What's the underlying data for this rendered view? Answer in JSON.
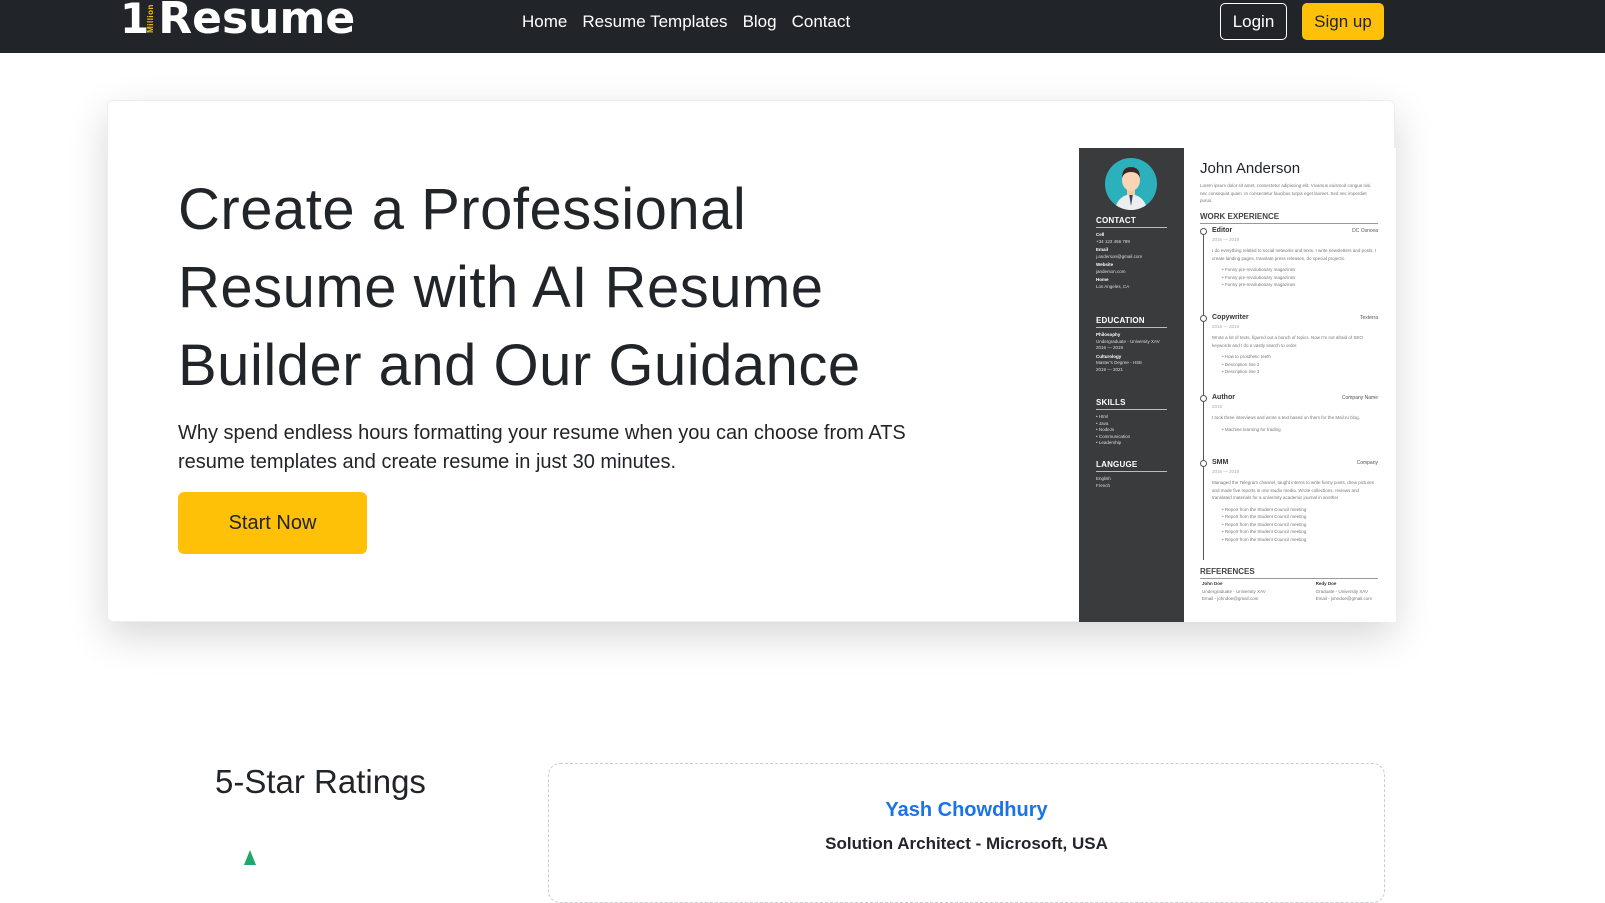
{
  "navbar": {
    "brand_one": "1",
    "brand_million": "Million",
    "brand_word": "Resume",
    "links": [
      {
        "label": "Home"
      },
      {
        "label": "Resume Templates"
      },
      {
        "label": "Blog"
      },
      {
        "label": "Contact"
      }
    ],
    "login_label": "Login",
    "signup_label": "Sign up"
  },
  "hero": {
    "title": "Create a Professional Resume with AI Resume Builder and Our Guidance",
    "subtitle": "Why spend endless hours formatting your resume when you can choose from ATS resume templates and create resume in just 30 minutes.",
    "cta_label": "Start Now"
  },
  "resume_preview": {
    "name": "John Anderson",
    "intro": "Lorem ipsum dolor sit amet, consectetur adipiscing elit. Vivamus euismod congue nisi, nec consequat quam. In consectetur faucibus turpis eget laoreet. Sed nec imperdiet purus.",
    "contact_heading": "CONTACT",
    "contact": [
      {
        "label": "Cell",
        "value": "+34 123 456 789"
      },
      {
        "label": "Email",
        "value": "j.anderson@gmail.com"
      },
      {
        "label": "Website",
        "value": "janderson.com"
      },
      {
        "label": "Home",
        "value": "Los Angeles, CA"
      }
    ],
    "education_heading": "EDUCATION",
    "education": [
      {
        "field": "Philosophy",
        "detail": "Undergraduate - University XAV",
        "years": "2016 — 2019"
      },
      {
        "field": "Culturology",
        "detail": "Master's Degree - HSE",
        "years": "2019 — 2021"
      }
    ],
    "skills_heading": "SKILLS",
    "skills": [
      "• Html",
      "• Java",
      "• NodeJs",
      "• Communication",
      "• Leadership"
    ],
    "language_heading": "LANGUGE",
    "languages": [
      "English",
      "French"
    ],
    "work_heading": "WORK EXPERIENCE",
    "jobs": [
      {
        "title": "Editor",
        "company": "DC Osnova",
        "dates": "2016 — 2019",
        "desc": "I do everything related to social networks and texts. I write newsletters and posts, I create landing pages, translate press releases, do special projects.",
        "bullets": [
          "Funny pre-revolutionary magazines",
          "Funny pre-revolutionary magazines",
          "Funny pre-revolutionary magazines"
        ]
      },
      {
        "title": "Copywriter",
        "company": "Texterra",
        "dates": "2016 — 2019",
        "desc": "Wrote a lot of texts, figured out a bunch of topics. Now I'm not afraid of SEO keywords and I do a vastly search to order.",
        "bullets": [
          "How to prosthetic teeth",
          "Description line 2",
          "Description line 3"
        ]
      },
      {
        "title": "Author",
        "company": "Company Name",
        "dates": "2016",
        "desc": "I took three interviews and wrote a text based on them for the Mail.ru blog.",
        "bullets": [
          "Machine learning for trading"
        ]
      },
      {
        "title": "SMM",
        "company": "Company",
        "dates": "2016 — 2019",
        "desc": "Managed the Telegram channel, taught interns to write funny posts, drew pictures and made five reports in one studio media. Wrote collections, reviews and translated materials for a university academic journal in another",
        "bullets": [
          "Report from the Student Council meeting",
          "Report from the Student Council meeting",
          "Report from the Student Council meeting",
          "Report from the Student Council meeting",
          "Report from the Student Council meeting"
        ]
      }
    ],
    "references_heading": "REFERENCES",
    "references": [
      {
        "name": "John Doe",
        "detail": "Undergraduate - University XAV",
        "email": "Email - johndoe@gmail.com"
      },
      {
        "name": "Redy Doe",
        "detail": "Graduate - University XAV",
        "email": "Email - johndoe@gmail.com"
      }
    ]
  },
  "ratings": {
    "title": "5-Star Ratings",
    "testimonial_name": "Yash Chowdhury",
    "testimonial_role": "Solution Architect - Microsoft, USA"
  },
  "colors": {
    "navbar_bg": "#212529",
    "accent_yellow": "#ffc107",
    "link_blue": "#1a73e8",
    "resume_sidebar": "#3a3b3c",
    "avatar_teal": "#2cb1bc"
  }
}
